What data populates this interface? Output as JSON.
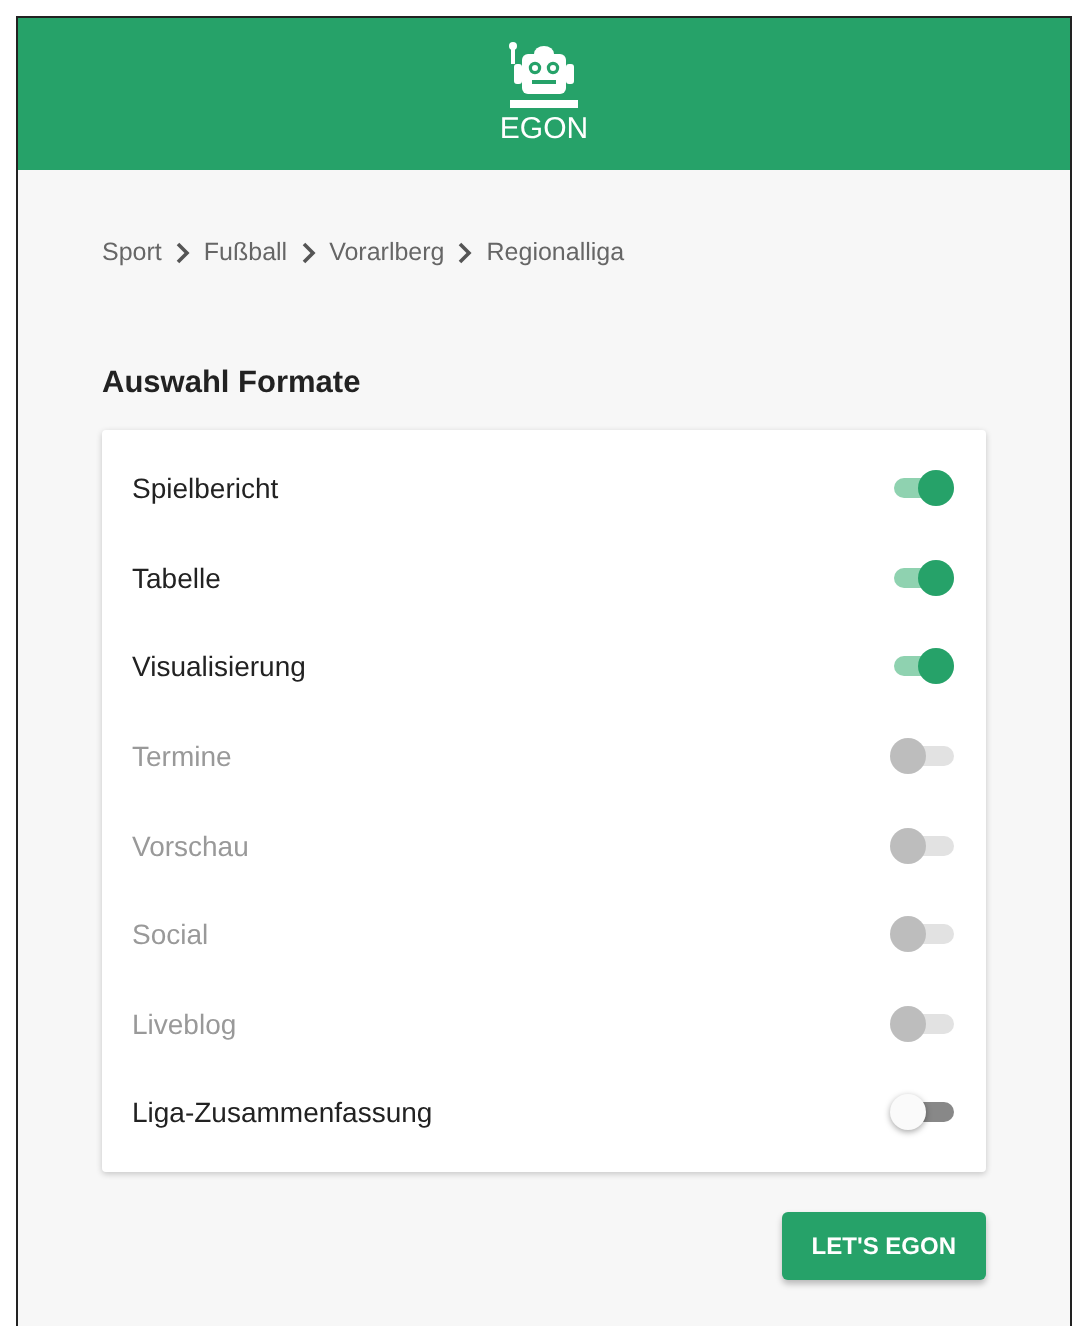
{
  "header": {
    "logo_text": "EGON"
  },
  "breadcrumb": [
    "Sport",
    "Fußball",
    "Vorarlberg",
    "Regionalliga"
  ],
  "section_title": "Auswahl Formate",
  "formats": [
    {
      "label": "Spielbericht",
      "on": true,
      "disabled": false
    },
    {
      "label": "Tabelle",
      "on": true,
      "disabled": false
    },
    {
      "label": "Visualisierung",
      "on": true,
      "disabled": false
    },
    {
      "label": "Termine",
      "on": false,
      "disabled": true
    },
    {
      "label": "Vorschau",
      "on": false,
      "disabled": true
    },
    {
      "label": "Social",
      "on": false,
      "disabled": true
    },
    {
      "label": "Liveblog",
      "on": false,
      "disabled": true
    },
    {
      "label": "Liga-Zusammenfassung",
      "on": false,
      "disabled": false
    }
  ],
  "button": "LET'S EGON"
}
